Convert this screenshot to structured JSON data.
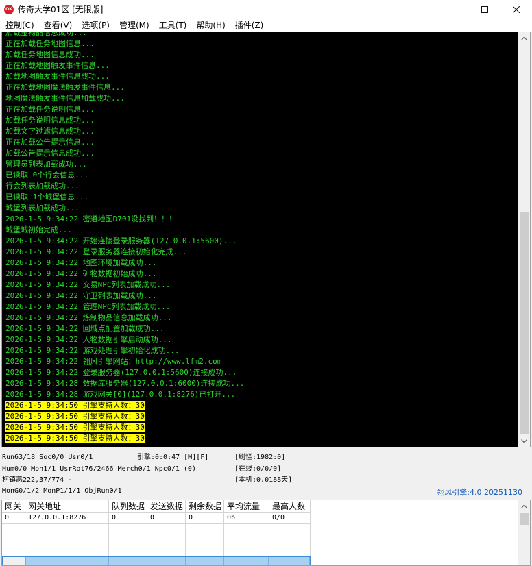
{
  "window": {
    "title": "传奇大学01区 [无限版]",
    "icon_text": "OK",
    "icon": "app-logo-icon",
    "controls": [
      "minimize-icon",
      "maximize-icon",
      "close-icon"
    ]
  },
  "menu": [
    "控制(C)",
    "查看(V)",
    "选项(P)",
    "管理(M)",
    "工具(T)",
    "帮助(H)",
    "插件(Z)"
  ],
  "log": [
    "加载金物品信息成功...",
    "正在加载任务地图信息...",
    "加载任务地图信息成功...",
    "正在加载地图触发事件信息...",
    "加载地图触发事件信息成功...",
    "正在加载地图魔法触发事件信息...",
    "地图魔法触发事件信息加载成功...",
    "正在加载任务说明信息...",
    "加载任务说明信息成功...",
    "加载文字过滤信息成功...",
    "正在加载公告提示信息...",
    "加载公告提示信息成功...",
    "管理员列表加载成功...",
    "已读取 0个行会信息...",
    "行会列表加载成功...",
    "已读取 1个城堡信息...",
    "城堡列表加载成功...",
    "2026-1-5 9:34:22 密道地图D701没找到！！！",
    "城堡城初始完成...",
    "2026-1-5 9:34:22 开始连接登录服务器(127.0.0.1:5600)...",
    "2026-1-5 9:34:22 登录服务器连接初始化完成...",
    "2026-1-5 9:34:22 地图环境加载成功...",
    "2026-1-5 9:34:22 矿物数据初始成功...",
    "2026-1-5 9:34:22 交易NPC列表加载成功...",
    "2026-1-5 9:34:22 守卫列表加载成功...",
    "2026-1-5 9:34:22 管理NPC列表加载成功...",
    "2026-1-5 9:34:22 炼制物品信息加载成功...",
    "2026-1-5 9:34:22 回城点配置加载成功...",
    "2026-1-5 9:34:22 人物数据引擎启动成功...",
    "2026-1-5 9:34:22 游戏处理引擎初始化成功...",
    "2026-1-5 9:34:22 翎风引擎网站：http://www.lfm2.com",
    "2026-1-5 9:34:22 登录服务器(127.0.0.1:5600)连接成功...",
    "2026-1-5 9:34:28 数据库服务器(127.0.0.1:6000)连接成功...",
    "2026-1-5 9:34:28 游戏网关[0](127.0.0.1:8276)已打开..."
  ],
  "log_highlight": [
    "2026-1-5 9:34:50 引擎支持人数：30",
    "2026-1-5 9:34:50 引擎支持人数：30",
    "2026-1-5 9:34:50 引擎支持人数：30",
    "2026-1-5 9:34:50 引擎支持人数：30"
  ],
  "status": {
    "line1_left": "Run63/18 Soc0/0 Usr0/1",
    "engine": "引擎:0:0:47 [M][F]",
    "refresh": "[刷怪:1982:0]",
    "line2_left": "Hum0/0 Mon1/1 UsrRot76/2466 Merch0/1 Npc0/1 (0)",
    "online": "[在线:0/0/0]",
    "line3_left": "柯镇恶222,37/774 -",
    "local": "[本机:0.0188天]",
    "line4_left": "MonG0/1/2 MonP1/1/1 ObjRun0/1",
    "brand": "翎风引擎:4.0 20251130"
  },
  "grid": {
    "headers": [
      "网关",
      "网关地址",
      "队列数据",
      "发送数据",
      "剩余数据",
      "平均流量",
      "最高人数"
    ],
    "rows": [
      [
        "0",
        "127.0.0.1:8276",
        "0",
        "0",
        "0",
        "0b",
        "0/0"
      ]
    ]
  },
  "colors": {
    "console_bg": "#000000",
    "console_text": "#2fd62f",
    "highlight_bg": "#ffff00",
    "brand_text": "#1058b8",
    "selection": "#a8d0f0"
  }
}
